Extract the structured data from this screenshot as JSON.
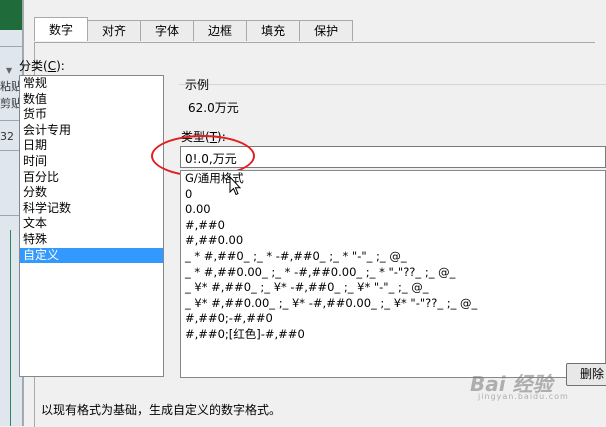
{
  "background": {
    "paste_label": "粘贴",
    "cut_label": "剪贴",
    "num_fragment": "32"
  },
  "tabs": [
    {
      "label": "数字",
      "active": true
    },
    {
      "label": "对齐"
    },
    {
      "label": "字体"
    },
    {
      "label": "边框"
    },
    {
      "label": "填充"
    },
    {
      "label": "保护"
    }
  ],
  "category": {
    "label": "分类(",
    "accel": "C",
    "label_end": "):",
    "items": [
      "常规",
      "数值",
      "货币",
      "会计专用",
      "日期",
      "时间",
      "百分比",
      "分数",
      "科学记数",
      "文本",
      "特殊",
      "自定义"
    ],
    "selected_index": 11
  },
  "sample": {
    "label": "示例",
    "value": "62.0万元"
  },
  "type": {
    "label": "类型(",
    "accel": "T",
    "label_end": "):",
    "value": "0!.0,万元"
  },
  "formats": [
    "G/通用格式",
    "0",
    "0.00",
    "#,##0",
    "#,##0.00",
    "_ * #,##0_ ;_ * -#,##0_ ;_ * \"-\"_ ;_ @_",
    "_ * #,##0.00_ ;_ * -#,##0.00_ ;_ * \"-\"??_ ;_ @_",
    "_ ¥* #,##0_ ;_ ¥* -#,##0_ ;_ ¥* \"-\"_ ;_ @_",
    "_ ¥* #,##0.00_ ;_ ¥* -#,##0.00_ ;_ ¥* \"-\"??_ ;_ @_",
    "#,##0;-#,##0",
    "#,##0;[红色]-#,##0"
  ],
  "delete_button": "删除",
  "hint": "以现有格式为基础，生成自定义的数字格式。",
  "watermark": {
    "main": "Bai 经验",
    "sub": "jingyan.baidu.com"
  },
  "colors": {
    "selection": "#3399ff",
    "annotation": "#e02020"
  }
}
